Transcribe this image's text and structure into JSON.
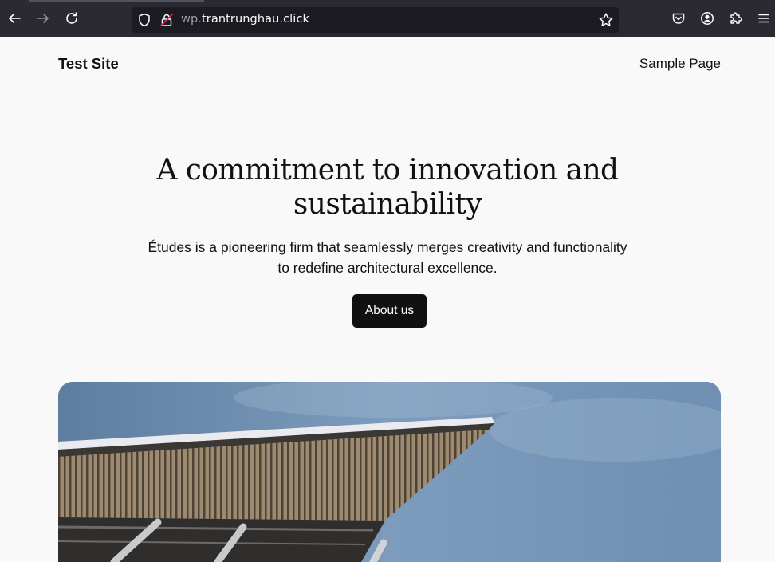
{
  "browser": {
    "url_prefix": "wp.",
    "url_domain": "trantrunghau.click",
    "icons": {
      "back": "arrow-left-icon",
      "forward": "arrow-right-icon",
      "reload": "reload-icon",
      "shield": "shield-icon",
      "lock": "insecure-lock-icon",
      "bookmark": "star-icon",
      "pocket": "pocket-icon",
      "account": "account-icon",
      "extensions": "puzzle-icon",
      "menu": "hamburger-menu-icon"
    },
    "colors": {
      "toolbar": "#2b2a33",
      "urlbar": "#1c1b22"
    }
  },
  "site": {
    "title": "Test Site",
    "nav": [
      "Sample Page"
    ]
  },
  "hero": {
    "heading": "A commitment to innovation and sustainability",
    "text": "Études is a pioneering firm that seamlessly merges creativity and functionality to redefine architectural excellence.",
    "button_label": "About us"
  },
  "colors": {
    "page_bg": "#f9f9f9",
    "text": "#111111",
    "button_bg": "#111111",
    "button_text": "#ffffff"
  }
}
